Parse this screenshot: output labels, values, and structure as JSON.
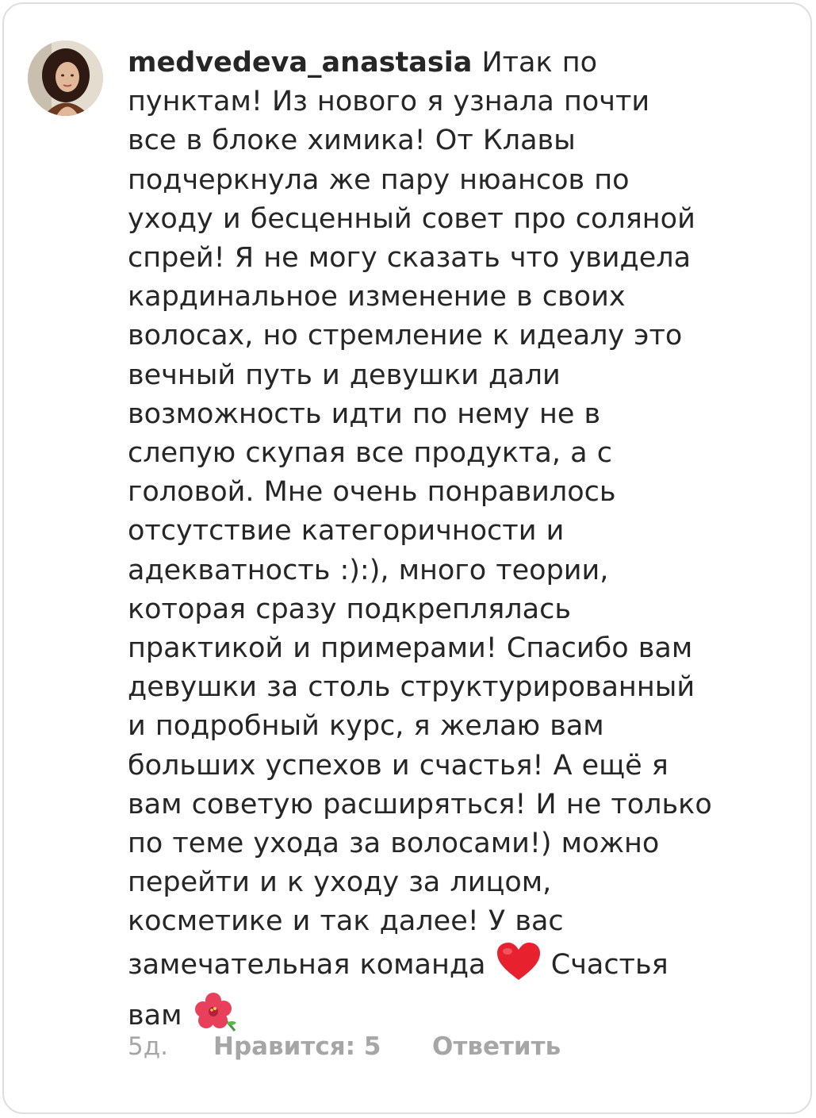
{
  "comment": {
    "username": "medvedeva_anastasia",
    "text": " Итак по\nпунктам! Из нового я узнала почти\nвсе в блоке химика! От Клавы\nподчеркнула же пару нюансов по\nуходу и бесценный совет про соляной\nспрей! Я не могу сказать что увидела\nкардинальное изменение в своих\nволосах, но стремление к идеалу  это\nвечный путь и девушки дали\nвозможность идти по нему не в\nслепую скупая все продукта, а с\nголовой. Мне очень понравилось\nотсутствие категоричности и\nадекватность :):), много теории,\nкоторая сразу подкреплялась\nпрактикой и примерами! Спасибо вам\nдевушки за столь структурированный\nи подробный курс, я желаю вам\nбольших успехов и счастья! А ещё я\nвам советую расширяться! И не только\nпо теме ухода за волосами!) можно\nперейти и к уходу за лицом,\nкосметике и так далее! У вас\nзамечательная команда ",
    "text_after_heart": " Счастья\nвам ",
    "emoji_heart": "heart-icon",
    "emoji_flower": "hibiscus-icon",
    "meta": {
      "time": "5д.",
      "likes": "Нравится: 5",
      "reply": "Ответить"
    }
  },
  "colors": {
    "text": "#262626",
    "meta": "#a6a6a6",
    "heart": "#e8212f",
    "border": "#dedede"
  }
}
